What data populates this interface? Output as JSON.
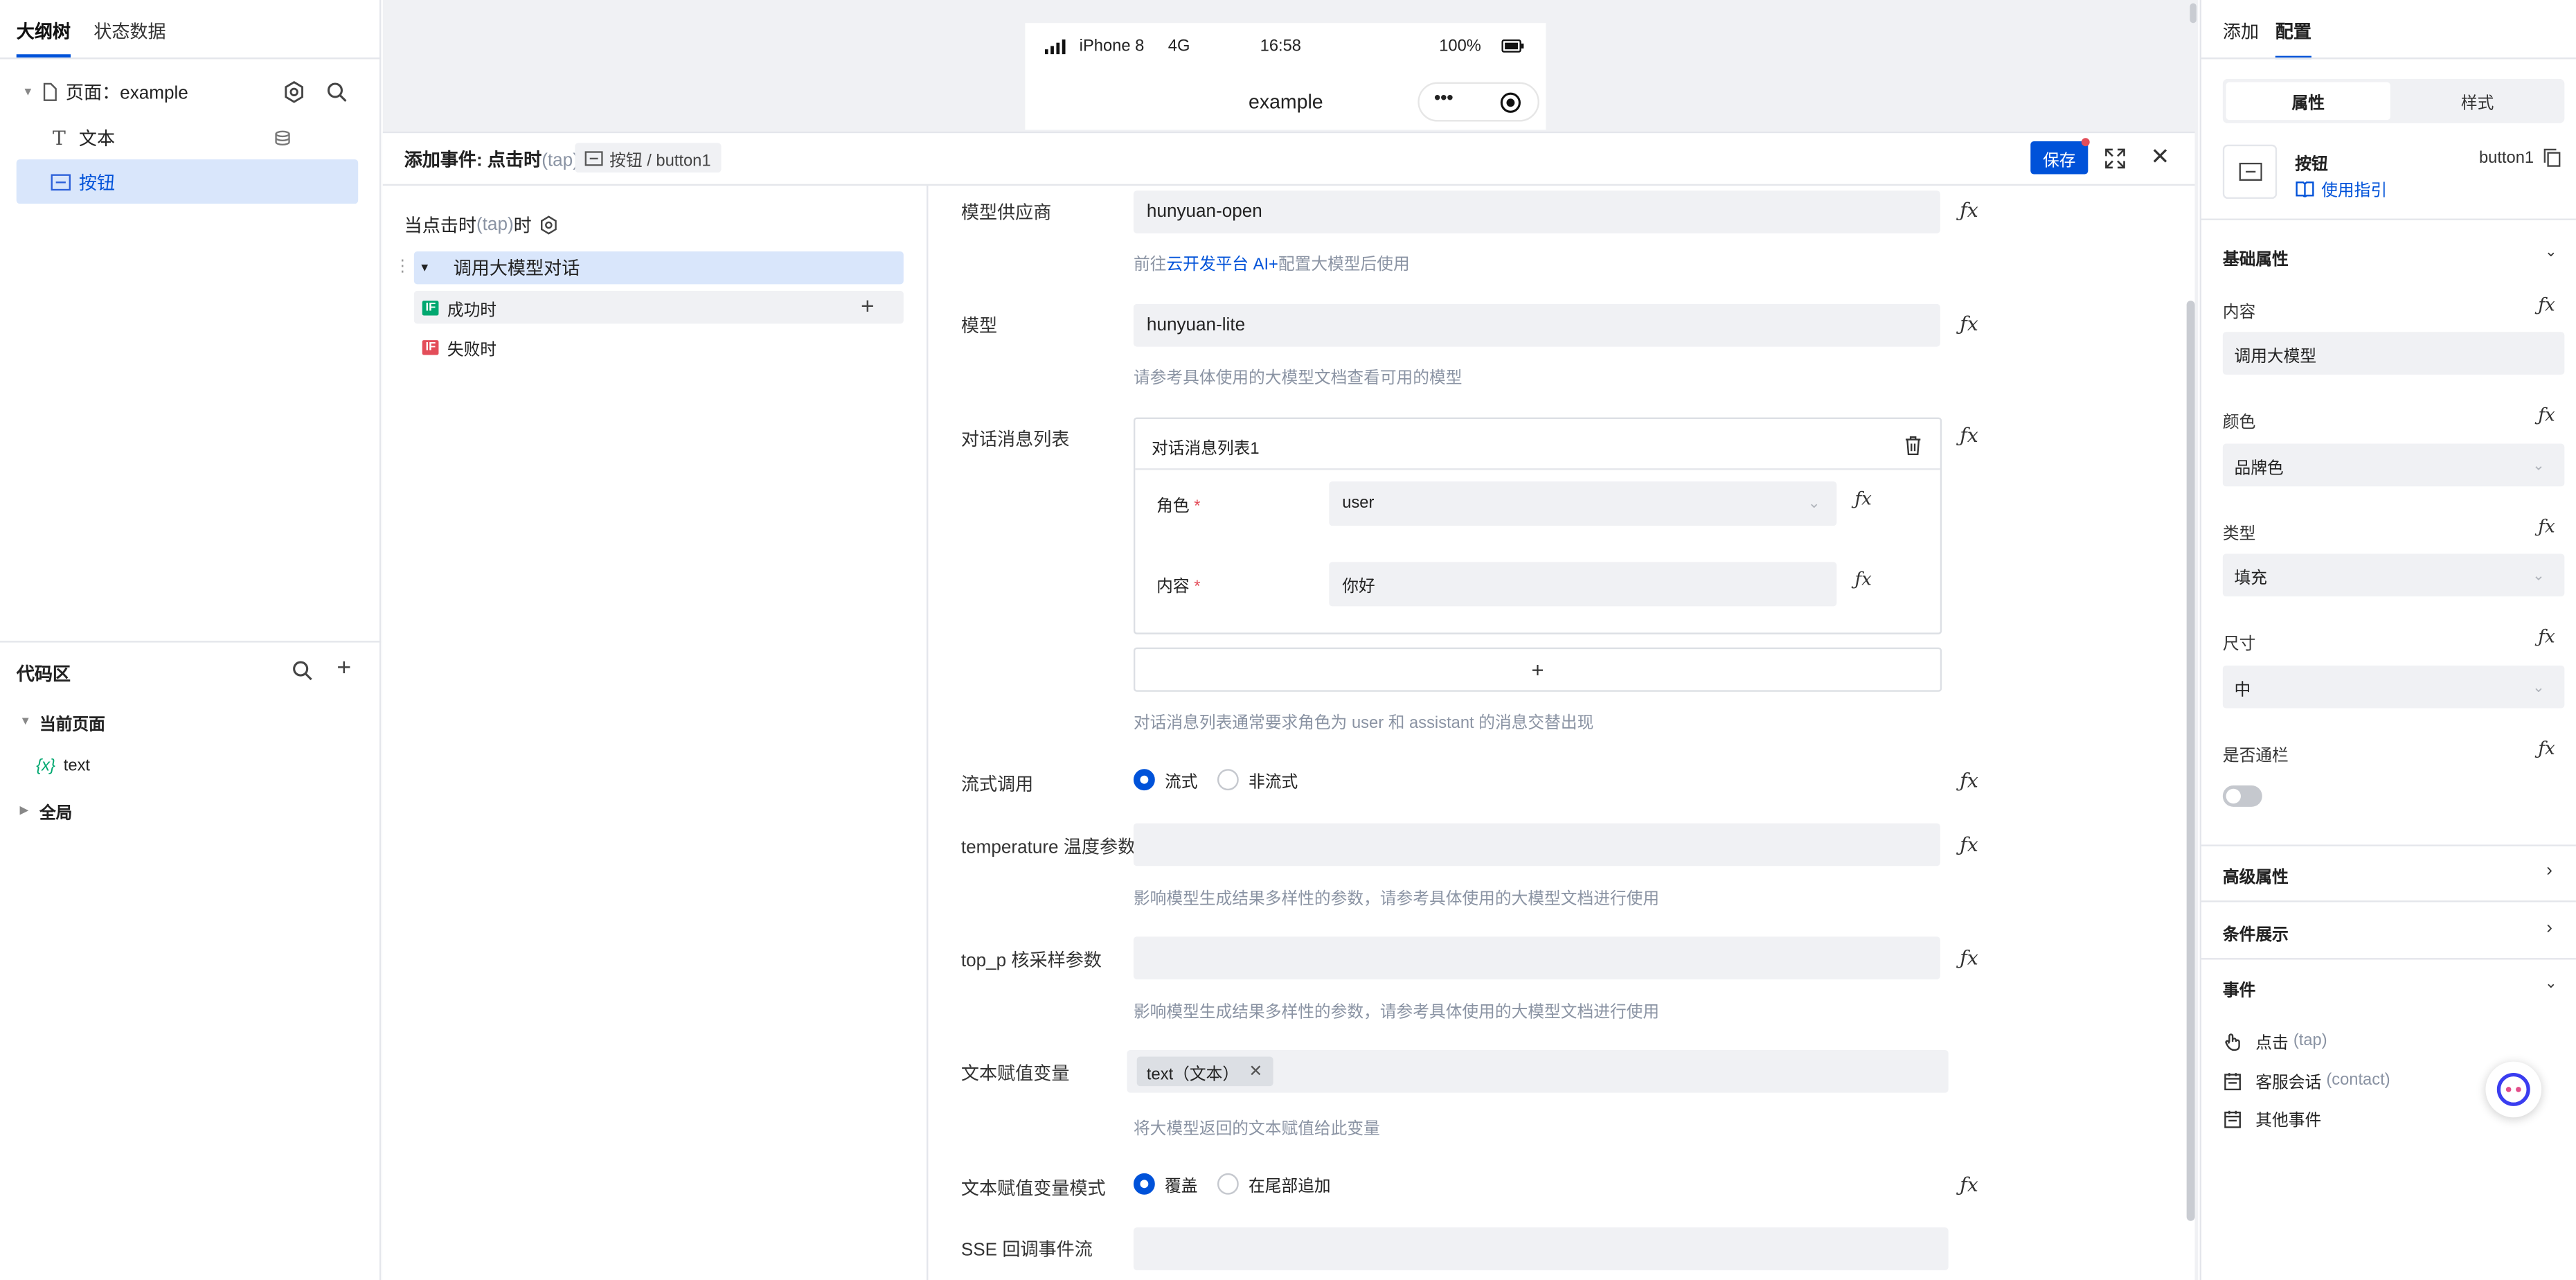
{
  "left_panel": {
    "tabs": [
      "大纲树",
      "状态数据"
    ],
    "tree": {
      "page_label": "页面：example",
      "text_node": "文本",
      "button_node": "按钮"
    },
    "code_area": {
      "title": "代码区",
      "current_page": "当前页面",
      "var_prefix": "{x}",
      "var_name": "text",
      "global": "全局"
    }
  },
  "phone": {
    "carrier": "iPhone 8",
    "network": "4G",
    "time": "16:58",
    "battery": "100%",
    "title": "example",
    "menu_glyph": "•••"
  },
  "event_editor": {
    "header_prefix": "添加事件: 点击时",
    "header_tap": "(tap)",
    "breadcrumb": "按钮 / button1",
    "save_label": "保存",
    "flow": {
      "trigger": "当点击时",
      "trigger_tap": "(tap)",
      "trigger_suffix": "时",
      "action": "调用大模型对话",
      "success_badge": "IF",
      "success": "成功时",
      "fail_badge": "IF",
      "fail": "失败时"
    },
    "form": {
      "provider_label": "模型供应商",
      "provider_value": "hunyuan-open",
      "provider_hint_pre": "前往",
      "provider_hint_link": "云开发平台 AI+",
      "provider_hint_post": "配置大模型后使用",
      "model_label": "模型",
      "model_value": "hunyuan-lite",
      "model_hint": "请参考具体使用的大模型文档查看可用的模型",
      "messages_label": "对话消息列表",
      "messages_card_title": "对话消息列表1",
      "role_label": "角色",
      "role_value": "user",
      "content_label": "内容",
      "content_value": "你好",
      "add_glyph": "+",
      "messages_hint": "对话消息列表通常要求角色为 user 和 assistant 的消息交替出现",
      "stream_label": "流式调用",
      "stream_opt1": "流式",
      "stream_opt2": "非流式",
      "temp_label": "temperature 温度参数",
      "temp_hint": "影响模型生成结果多样性的参数，请参考具体使用的大模型文档进行使用",
      "topp_label": "top_p 核采样参数",
      "topp_hint": "影响模型生成结果多样性的参数，请参考具体使用的大模型文档进行使用",
      "textvar_label": "文本赋值变量",
      "textvar_tag": "text（文本）",
      "textvar_hint": "将大模型返回的文本赋值给此变量",
      "mode_label": "文本赋值变量模式",
      "mode_opt1": "覆盖",
      "mode_opt2": "在尾部追加",
      "sse_label": "SSE 回调事件流"
    },
    "fx": "ƒx"
  },
  "right_panel": {
    "tabs": [
      "添加",
      "配置"
    ],
    "seg": [
      "属性",
      "样式"
    ],
    "comp_name": "按钮",
    "comp_id": "button1",
    "guide": "使用指引",
    "basic_title": "基础属性",
    "content_label": "内容",
    "content_value": "调用大模型",
    "color_label": "颜色",
    "color_value": "品牌色",
    "type_label": "类型",
    "type_value": "填充",
    "size_label": "尺寸",
    "size_value": "中",
    "block_label": "是否通栏",
    "advanced": "高级属性",
    "condition": "条件展示",
    "events": "事件",
    "event_items": [
      {
        "name": "点击",
        "code": "(tap)"
      },
      {
        "name": "客服会话",
        "code": "(contact)"
      },
      {
        "name": "其他事件",
        "code": ""
      }
    ]
  },
  "colors": {
    "accent": "#0052d9",
    "selected_bg": "#d9e6fb",
    "success": "#00a870",
    "fail": "#e34d59"
  }
}
